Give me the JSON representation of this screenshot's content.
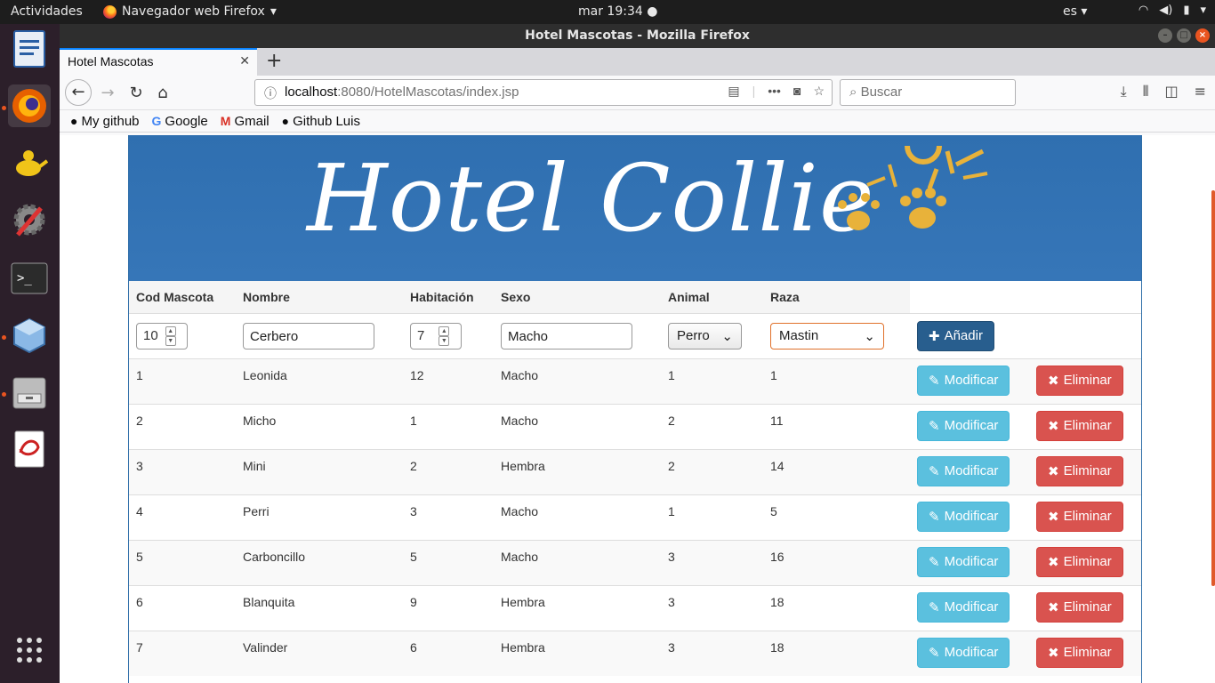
{
  "topbar": {
    "activities": "Actividades",
    "app_name": "Navegador web Firefox",
    "clock": "mar 19:34",
    "language": "es"
  },
  "window": {
    "title": "Hotel Mascotas - Mozilla Firefox"
  },
  "tab": {
    "title": "Hotel Mascotas"
  },
  "urlbar": {
    "host": "localhost",
    "rest": ":8080/HotelMascotas/index.jsp"
  },
  "search": {
    "placeholder": "Buscar"
  },
  "bookmarks": [
    {
      "label": "My github"
    },
    {
      "label": "Google"
    },
    {
      "label": "Gmail"
    },
    {
      "label": "Github Luis"
    }
  ],
  "banner": {
    "title": "Hotel Collie"
  },
  "table": {
    "headers": [
      "Cod Mascota",
      "Nombre",
      "Habitación",
      "Sexo",
      "Animal",
      "Raza"
    ],
    "form": {
      "cod": "10",
      "nombre": "Cerbero",
      "habitacion": "7",
      "sexo": "Macho",
      "animal": "Perro",
      "raza": "Mastin",
      "add_label": "Añadir"
    },
    "modify_label": "Modificar",
    "delete_label": "Eliminar",
    "rows": [
      {
        "cod": "1",
        "nombre": "Leonida",
        "habitacion": "12",
        "sexo": "Macho",
        "animal": "1",
        "raza": "1"
      },
      {
        "cod": "2",
        "nombre": "Micho",
        "habitacion": "1",
        "sexo": "Macho",
        "animal": "2",
        "raza": "11"
      },
      {
        "cod": "3",
        "nombre": "Mini",
        "habitacion": "2",
        "sexo": "Hembra",
        "animal": "2",
        "raza": "14"
      },
      {
        "cod": "4",
        "nombre": "Perri",
        "habitacion": "3",
        "sexo": "Macho",
        "animal": "1",
        "raza": "5"
      },
      {
        "cod": "5",
        "nombre": "Carboncillo",
        "habitacion": "5",
        "sexo": "Macho",
        "animal": "3",
        "raza": "16"
      },
      {
        "cod": "6",
        "nombre": "Blanquita",
        "habitacion": "9",
        "sexo": "Hembra",
        "animal": "3",
        "raza": "18"
      },
      {
        "cod": "7",
        "nombre": "Valinder",
        "habitacion": "6",
        "sexo": "Hembra",
        "animal": "3",
        "raza": "18"
      }
    ]
  },
  "colors": {
    "banner": "#2f6fb0",
    "paw": "#e8b23a",
    "add": "#285e8e",
    "modify": "#5bc0de",
    "delete": "#d9534f"
  }
}
